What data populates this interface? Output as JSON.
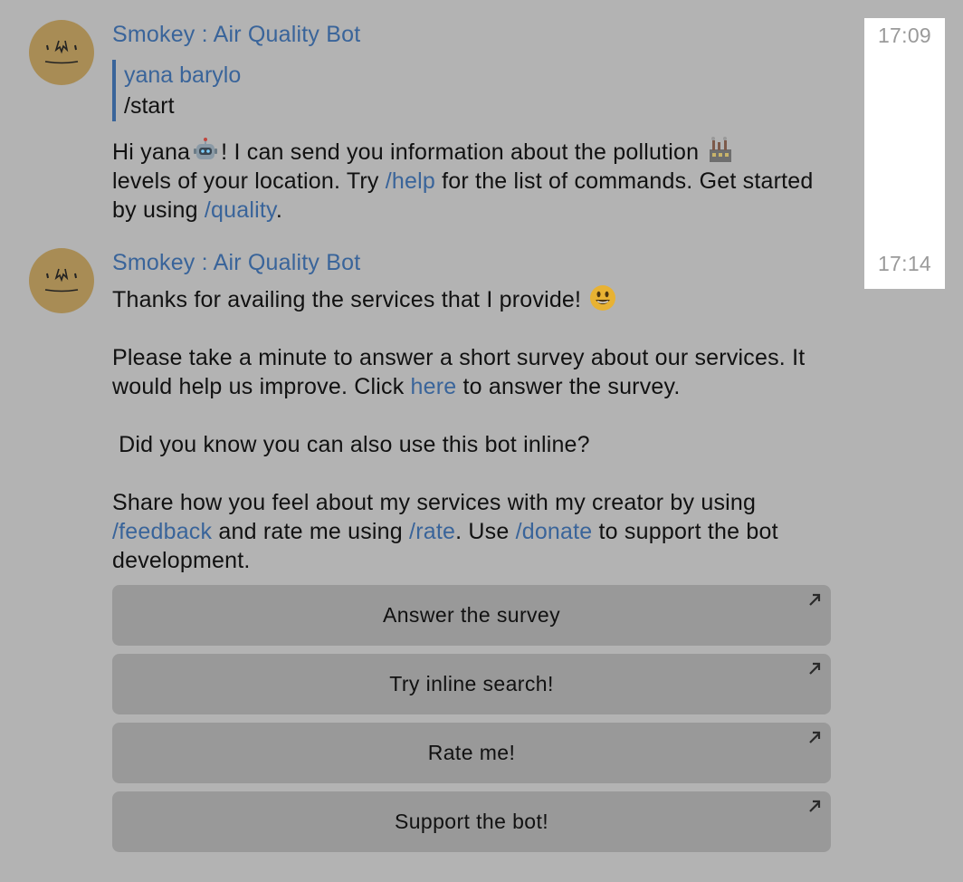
{
  "messages": [
    {
      "sender": "Smokey : Air Quality Bot",
      "time": "17:09",
      "reply": {
        "name": "yana barylo",
        "text": "/start"
      },
      "text": {
        "part1": "Hi yana",
        "emoji1": "robot-emoji",
        "part2": "! I can send you information about the pollution ",
        "emoji2": "factory-emoji",
        "part3": "levels of your location. Try ",
        "link_help": "/help",
        "part4": " for the list of commands. Get started by using ",
        "link_quality": "/quality",
        "part5": "."
      }
    },
    {
      "sender": "Smokey : Air Quality Bot",
      "time": "17:14",
      "text": {
        "line1": "Thanks for availing the services that I provide! ",
        "emoji1": "smiley-emoji",
        "para2_a": "Please take a minute to answer a short survey about our services. It would help us improve. Click ",
        "link_here": "here",
        "para2_b": " to answer the survey.",
        "para3": " Did you know you can also use this bot inline?",
        "para4_a": "Share how you feel about my services with my creator by using ",
        "link_feedback": "/feedback",
        "para4_b": " and rate me using ",
        "link_rate": "/rate",
        "para4_c": ". Use ",
        "link_donate": "/donate",
        "para4_d": " to support the bot development."
      },
      "buttons": [
        {
          "label": "Answer the survey",
          "icon": "external-link-arrow-icon"
        },
        {
          "label": "Try inline search!",
          "icon": "external-link-arrow-icon"
        },
        {
          "label": "Rate me!",
          "icon": "external-link-arrow-icon"
        },
        {
          "label": "Support the bot!",
          "icon": "external-link-arrow-icon"
        }
      ]
    }
  ],
  "colors": {
    "background": "#b3b3b3",
    "link": "#39649a",
    "button": "#999999",
    "avatar": "#a88c55",
    "time_panel": "#ffffff"
  }
}
